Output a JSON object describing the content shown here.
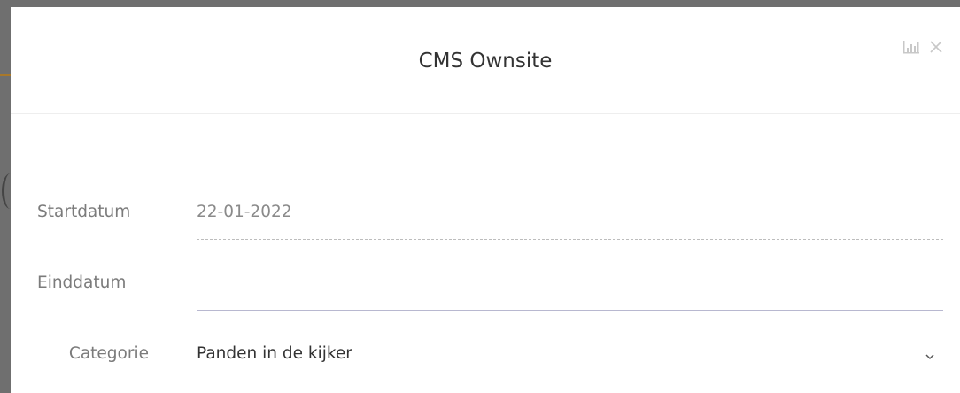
{
  "modal": {
    "title": "CMS Ownsite",
    "actions": {
      "stats_icon": "bar-chart-icon",
      "close_icon": "close-icon"
    }
  },
  "form": {
    "start_date": {
      "label": "Startdatum",
      "value": "22-01-2022"
    },
    "end_date": {
      "label": "Einddatum",
      "value": ""
    },
    "category": {
      "label": "Categorie",
      "value": "Panden in de kijker",
      "icon": "chevron-down-icon"
    }
  },
  "colors": {
    "title_text": "#333333",
    "label_text": "#7b7b7b",
    "underline": "#b8b8d0",
    "backdrop": "#6f6f6f"
  }
}
